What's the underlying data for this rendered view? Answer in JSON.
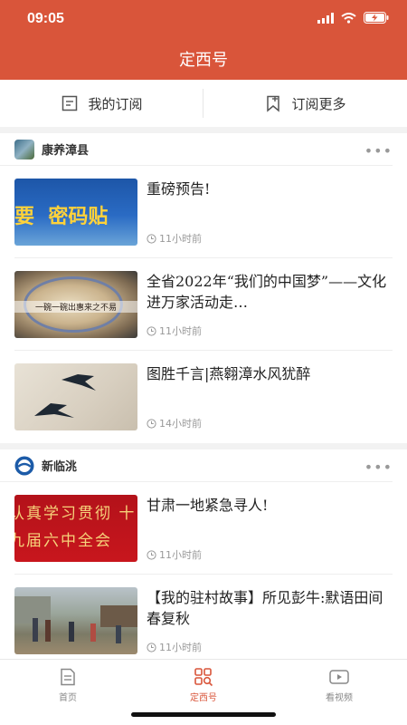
{
  "status": {
    "time": "09:05"
  },
  "header": {
    "title": "定西号"
  },
  "tabs": [
    {
      "label": "我的订阅",
      "icon": "subscription-list-icon"
    },
    {
      "label": "订阅更多",
      "icon": "bookmark-add-icon"
    }
  ],
  "sections": [
    {
      "name": "康养漳县",
      "items": [
        {
          "title": "重磅预告!",
          "time": "11小时前",
          "thumb_text": "要  密码贴"
        },
        {
          "title": "全省2022年“我们的中国梦”——文化进万家活动走…",
          "time": "11小时前",
          "thumb_text": "一碗一碗出惠来之不易"
        },
        {
          "title": "图胜千言|燕翱漳水风犹醉",
          "time": "14小时前",
          "thumb_text": ""
        }
      ]
    },
    {
      "name": "新临洮",
      "items": [
        {
          "title": "甘肃一地紧急寻人!",
          "time": "11小时前",
          "thumb_text": "认真学习贯彻 十九届六中全会"
        },
        {
          "title": "【我的驻村故事】所见彭牛:默语田间春复秋",
          "time": "11小时前",
          "thumb_text": ""
        }
      ]
    }
  ],
  "tabbar": [
    {
      "label": "首页",
      "icon": "home-doc-icon"
    },
    {
      "label": "定西号",
      "icon": "grid-search-icon",
      "active": true
    },
    {
      "label": "看视频",
      "icon": "video-play-icon"
    }
  ],
  "colors": {
    "brand": "#d9553a",
    "text": "#222222",
    "meta": "#999999"
  }
}
